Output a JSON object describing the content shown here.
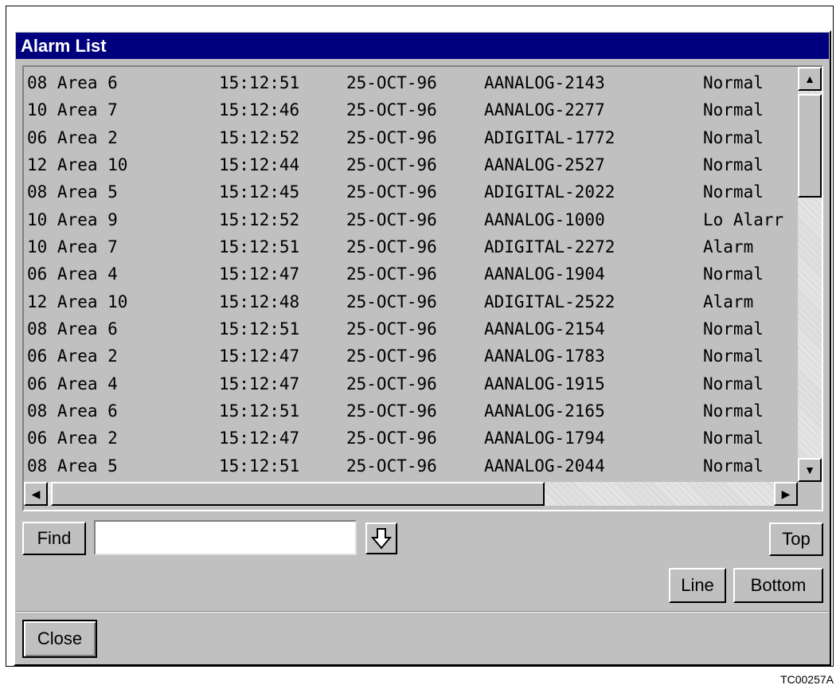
{
  "window": {
    "title": "Alarm List"
  },
  "alarms": [
    {
      "area": "08 Area 6",
      "time": "15:12:51",
      "date": "25-OCT-96",
      "tag": "AANALOG-2143",
      "status": "Normal"
    },
    {
      "area": "10 Area 7",
      "time": "15:12:46",
      "date": "25-OCT-96",
      "tag": "AANALOG-2277",
      "status": "Normal"
    },
    {
      "area": "06 Area 2",
      "time": "15:12:52",
      "date": "25-OCT-96",
      "tag": "ADIGITAL-1772",
      "status": "Normal"
    },
    {
      "area": "12 Area 10",
      "time": "15:12:44",
      "date": "25-OCT-96",
      "tag": "AANALOG-2527",
      "status": "Normal"
    },
    {
      "area": "08 Area 5",
      "time": "15:12:45",
      "date": "25-OCT-96",
      "tag": "ADIGITAL-2022",
      "status": "Normal"
    },
    {
      "area": "10 Area 9",
      "time": "15:12:52",
      "date": "25-OCT-96",
      "tag": "AANALOG-1000",
      "status": "Lo Alarr"
    },
    {
      "area": "10 Area 7",
      "time": "15:12:51",
      "date": "25-OCT-96",
      "tag": "ADIGITAL-2272",
      "status": "Alarm"
    },
    {
      "area": "06 Area 4",
      "time": "15:12:47",
      "date": "25-OCT-96",
      "tag": "AANALOG-1904",
      "status": "Normal"
    },
    {
      "area": "12 Area 10",
      "time": "15:12:48",
      "date": "25-OCT-96",
      "tag": "ADIGITAL-2522",
      "status": "Alarm"
    },
    {
      "area": "08 Area 6",
      "time": "15:12:51",
      "date": "25-OCT-96",
      "tag": "AANALOG-2154",
      "status": "Normal"
    },
    {
      "area": "06 Area 2",
      "time": "15:12:47",
      "date": "25-OCT-96",
      "tag": "AANALOG-1783",
      "status": "Normal"
    },
    {
      "area": "06 Area 4",
      "time": "15:12:47",
      "date": "25-OCT-96",
      "tag": "AANALOG-1915",
      "status": "Normal"
    },
    {
      "area": "08 Area 6",
      "time": "15:12:51",
      "date": "25-OCT-96",
      "tag": "AANALOG-2165",
      "status": "Normal"
    },
    {
      "area": "06 Area 2",
      "time": "15:12:47",
      "date": "25-OCT-96",
      "tag": "AANALOG-1794",
      "status": "Normal"
    },
    {
      "area": "08 Area 5",
      "time": "15:12:51",
      "date": "25-OCT-96",
      "tag": "AANALOG-2044",
      "status": "Normal"
    }
  ],
  "find": {
    "label": "Find",
    "value": "",
    "next_icon": "down-arrow-icon"
  },
  "buttons": {
    "top": "Top",
    "line": "Line",
    "bottom": "Bottom",
    "close": "Close"
  },
  "scroll_icons": {
    "up": "up-arrow-icon",
    "down": "down-arrow-icon",
    "left": "left-arrow-icon",
    "right": "right-arrow-icon"
  },
  "figure_id": "TC00257A",
  "colors": {
    "titlebar": "#00007f",
    "window": "#c0c0c0"
  }
}
